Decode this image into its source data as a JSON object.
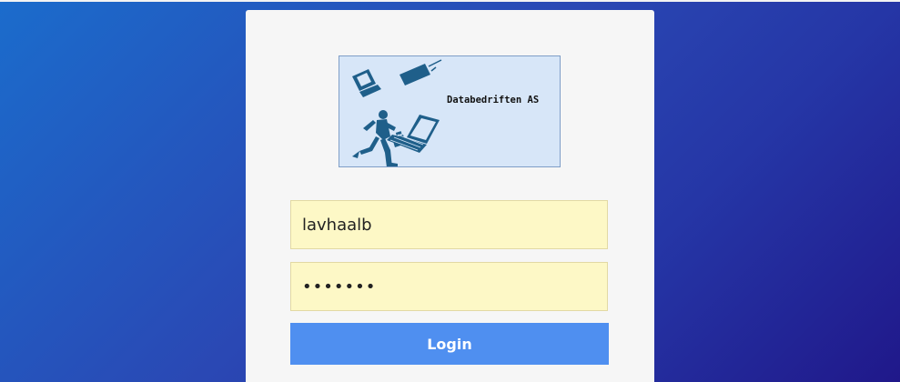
{
  "logo": {
    "text": "Databedriften AS"
  },
  "login_form": {
    "username_value": "lavhaalb",
    "password_value": "abcdefg",
    "login_label": "Login"
  },
  "colors": {
    "background_start": "#1b6ccc",
    "background_end": "#20188a",
    "card": "#f6f6f6",
    "field_fill": "#fdf8c6",
    "button": "#4f8ff0",
    "logo_fill": "#d7e6f8",
    "logo_ink": "#1f5f8a"
  },
  "icons": [
    "computer-icon",
    "cable-device-icon",
    "running-man-icon",
    "laptop-icon",
    "briefcase-icon"
  ]
}
